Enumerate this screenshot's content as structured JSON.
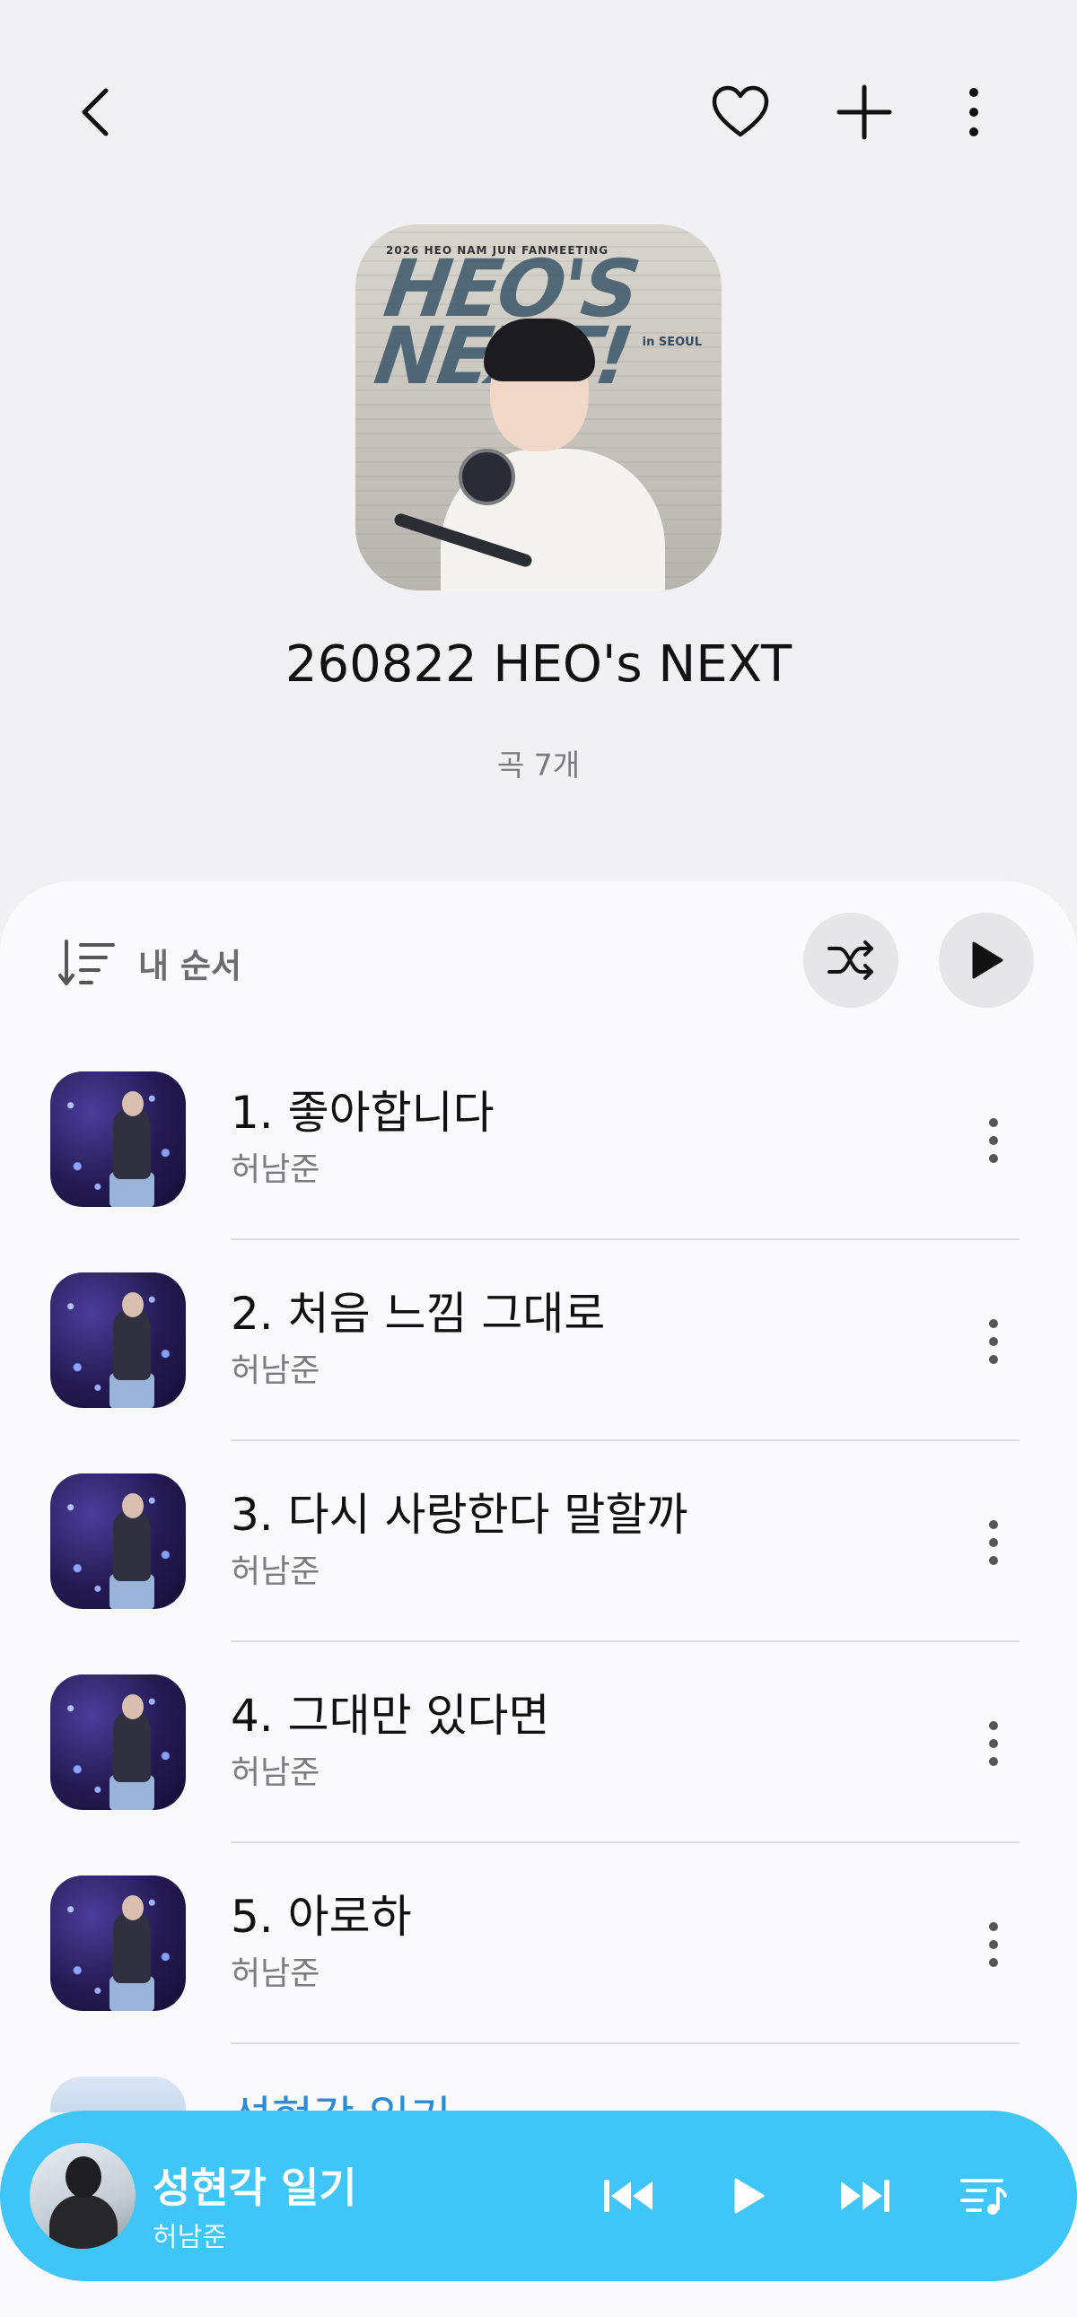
{
  "header": {
    "back_icon": "chevron-left-icon",
    "favorite_icon": "heart-outline-icon",
    "add_icon": "plus-icon",
    "more_icon": "more-vertical-icon"
  },
  "album": {
    "cover_text_top": "2026 HEO NAM JUN FANMEETING",
    "cover_text_big": "HEO'S NEXT!",
    "cover_text_place": "in SEOUL",
    "title": "260822 HEO's NEXT",
    "count": "곡 7개"
  },
  "controls": {
    "sort_icon": "sort-order-icon",
    "sort_label": "내 순서",
    "shuffle_icon": "shuffle-icon",
    "play_icon": "play-icon"
  },
  "tracks": [
    {
      "title": "1. 좋아합니다",
      "artist": "허남준"
    },
    {
      "title": "2. 처음 느낌 그대로",
      "artist": "허남준"
    },
    {
      "title": "3. 다시 사랑한다 말할까",
      "artist": "허남준"
    },
    {
      "title": "4. 그대만 있다면",
      "artist": "허남준"
    },
    {
      "title": "5. 아로하",
      "artist": "허남준"
    }
  ],
  "partial_track": {
    "title": "성현각 일기"
  },
  "now_playing": {
    "title": "성현각 일기",
    "artist": "허남준",
    "prev_icon": "skip-previous-icon",
    "play_icon": "play-icon",
    "next_icon": "skip-next-icon",
    "queue_icon": "playlist-icon",
    "accent_color": "#3fc5f7"
  }
}
